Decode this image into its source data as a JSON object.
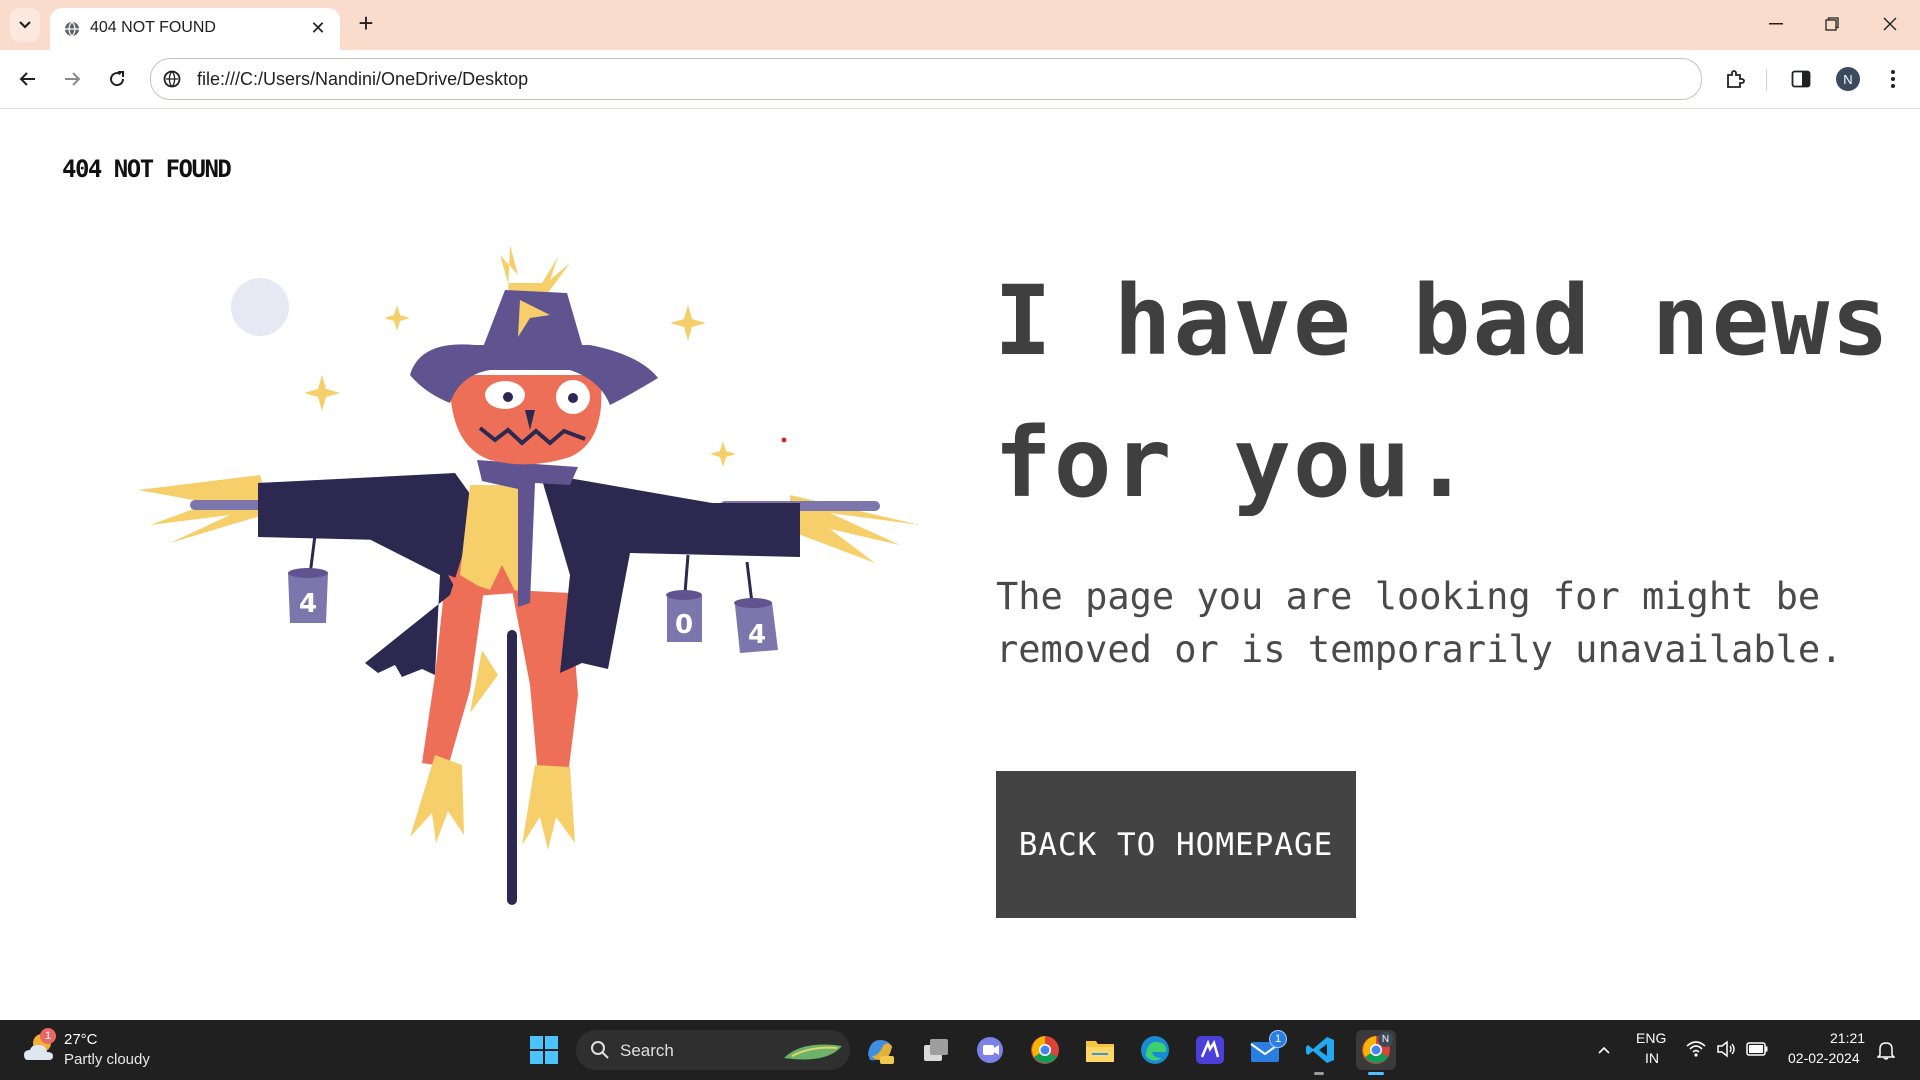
{
  "browser": {
    "tab_title": "404 NOT FOUND",
    "url": "file:///C:/Users/Nandini/OneDrive/Desktop",
    "profile_initial": "N"
  },
  "page": {
    "logo_text": "404 NOT FOUND",
    "headline_line1": "I have bad news",
    "headline_line2": "for you.",
    "subtext_line1": "The page you are looking for might be",
    "subtext_line2": "removed or is temporarily unavailable.",
    "button_label": "BACK TO HOMEPAGE",
    "can_digits": [
      "4",
      "0",
      "4"
    ]
  },
  "taskbar": {
    "weather_temp": "27°C",
    "weather_desc": "Partly cloudy",
    "weather_badge": "1",
    "search_label": "Search",
    "mail_badge": "1",
    "chrome_profile_badge": "N",
    "lang_line1": "ENG",
    "lang_line2": "IN",
    "time": "21:21",
    "date": "02-02-2024"
  },
  "colors": {
    "accent_dark": "#434343",
    "tab_strip": "#f9dccc",
    "scarecrow_hat": "#5f5490",
    "scarecrow_coat": "#2d2850",
    "scarecrow_face": "#ee6f57",
    "straw": "#f6cf6a"
  }
}
